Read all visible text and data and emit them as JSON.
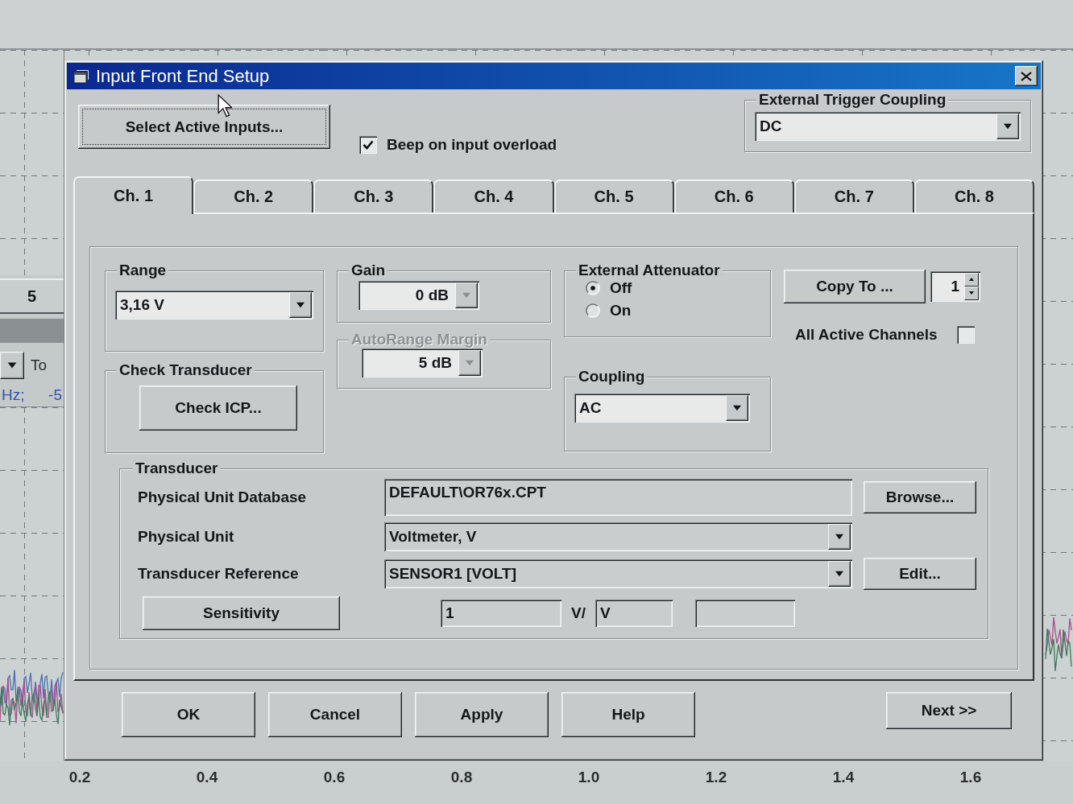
{
  "background": {
    "left_panel": {
      "value": "5",
      "to_label": "To",
      "unit": "Hz;",
      "reading": "-5"
    },
    "x_axis_labels": [
      "0.2",
      "0.4",
      "0.6",
      "0.8",
      "1.0",
      "1.2",
      "1.4",
      "1.6"
    ]
  },
  "dialog": {
    "title": "Input Front End Setup"
  },
  "select_inputs_button": {
    "label": "Select Active Inputs..."
  },
  "beep_on_overload": {
    "label": "Beep on input overload",
    "checked": true
  },
  "external_trigger_coupling": {
    "title": "External Trigger Coupling",
    "value": "DC"
  },
  "tabs": [
    {
      "label": "Ch. 1",
      "selected": true
    },
    {
      "label": "Ch. 2",
      "selected": false
    },
    {
      "label": "Ch. 3",
      "selected": false
    },
    {
      "label": "Ch. 4",
      "selected": false
    },
    {
      "label": "Ch. 5",
      "selected": false
    },
    {
      "label": "Ch. 6",
      "selected": false
    },
    {
      "label": "Ch. 7",
      "selected": false
    },
    {
      "label": "Ch. 8",
      "selected": false
    }
  ],
  "range": {
    "title": "Range",
    "value": "3,16 V"
  },
  "check_transducer": {
    "title": "Check Transducer",
    "button": {
      "label": "Check ICP..."
    }
  },
  "gain": {
    "title": "Gain",
    "value": "0 dB",
    "dropdown_disabled": true
  },
  "autorange_margin": {
    "title": "AutoRange Margin",
    "disabled": true,
    "value": "5 dB",
    "dropdown_disabled": true
  },
  "external_attenuator": {
    "title": "External Attenuator",
    "options": [
      {
        "label": "Off",
        "selected": true
      },
      {
        "label": "On",
        "selected": false
      }
    ]
  },
  "coupling": {
    "title": "Coupling",
    "value": "AC"
  },
  "copy_to": {
    "button": {
      "label": "Copy To ..."
    },
    "count": "1",
    "all_active_channels": {
      "label": "All Active Channels",
      "checked": false
    }
  },
  "transducer": {
    "title": "Transducer",
    "rows": [
      {
        "kind": "text",
        "label": "Physical Unit Database",
        "value": "DEFAULT\\OR76x.CPT",
        "button": {
          "label": "Browse..."
        }
      },
      {
        "kind": "dropdown",
        "label": "Physical Unit",
        "value": "Voltmeter, V"
      },
      {
        "kind": "dropdown",
        "label": "Transducer Reference",
        "value": "SENSOR1 [VOLT]",
        "button": {
          "label": "Edit..."
        }
      }
    ],
    "sensitivity": {
      "button": {
        "label": "Sensitivity"
      },
      "value": "1",
      "separator": "V/",
      "unit": "V"
    }
  },
  "buttons": [
    {
      "label": "OK"
    },
    {
      "label": "Cancel"
    },
    {
      "label": "Apply"
    },
    {
      "label": "Help"
    }
  ],
  "next_button": {
    "label": "Next >>"
  }
}
